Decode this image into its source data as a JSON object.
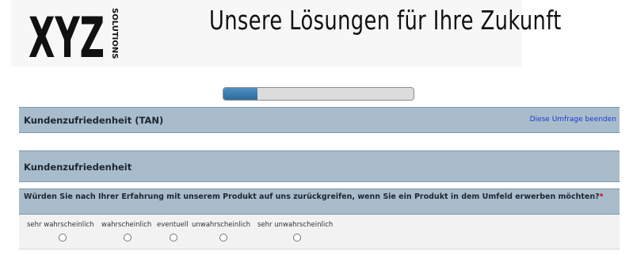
{
  "header": {
    "logo_text": "XYZ",
    "logo_sub": "SOLUTIONS",
    "tagline": "Unsere Lösungen für Ihre Zukunft"
  },
  "progress": {
    "percent": 18
  },
  "survey": {
    "title": "Kundenzufriedenheit (TAN)",
    "exit_link": "Diese Umfrage beenden",
    "group_title": "Kundenzufriedenheit",
    "question": {
      "text": "Würden Sie nach Ihrer Erfahrung mit unserem Produkt auf uns zurückgreifen, wenn Sie ein Produkt in dem Umfeld erwerben möchten?",
      "required_mark": "*",
      "options": [
        "sehr wahrscheinlich",
        "wahrscheinlich",
        "eventuell",
        "unwahrscheinlich",
        "sehr unwahrscheinlich"
      ]
    }
  },
  "colors": {
    "bar_bg": "#a8bccb",
    "progress_fill": "#3a7cb0",
    "link": "#1a3ad6",
    "required": "#e0001a"
  }
}
